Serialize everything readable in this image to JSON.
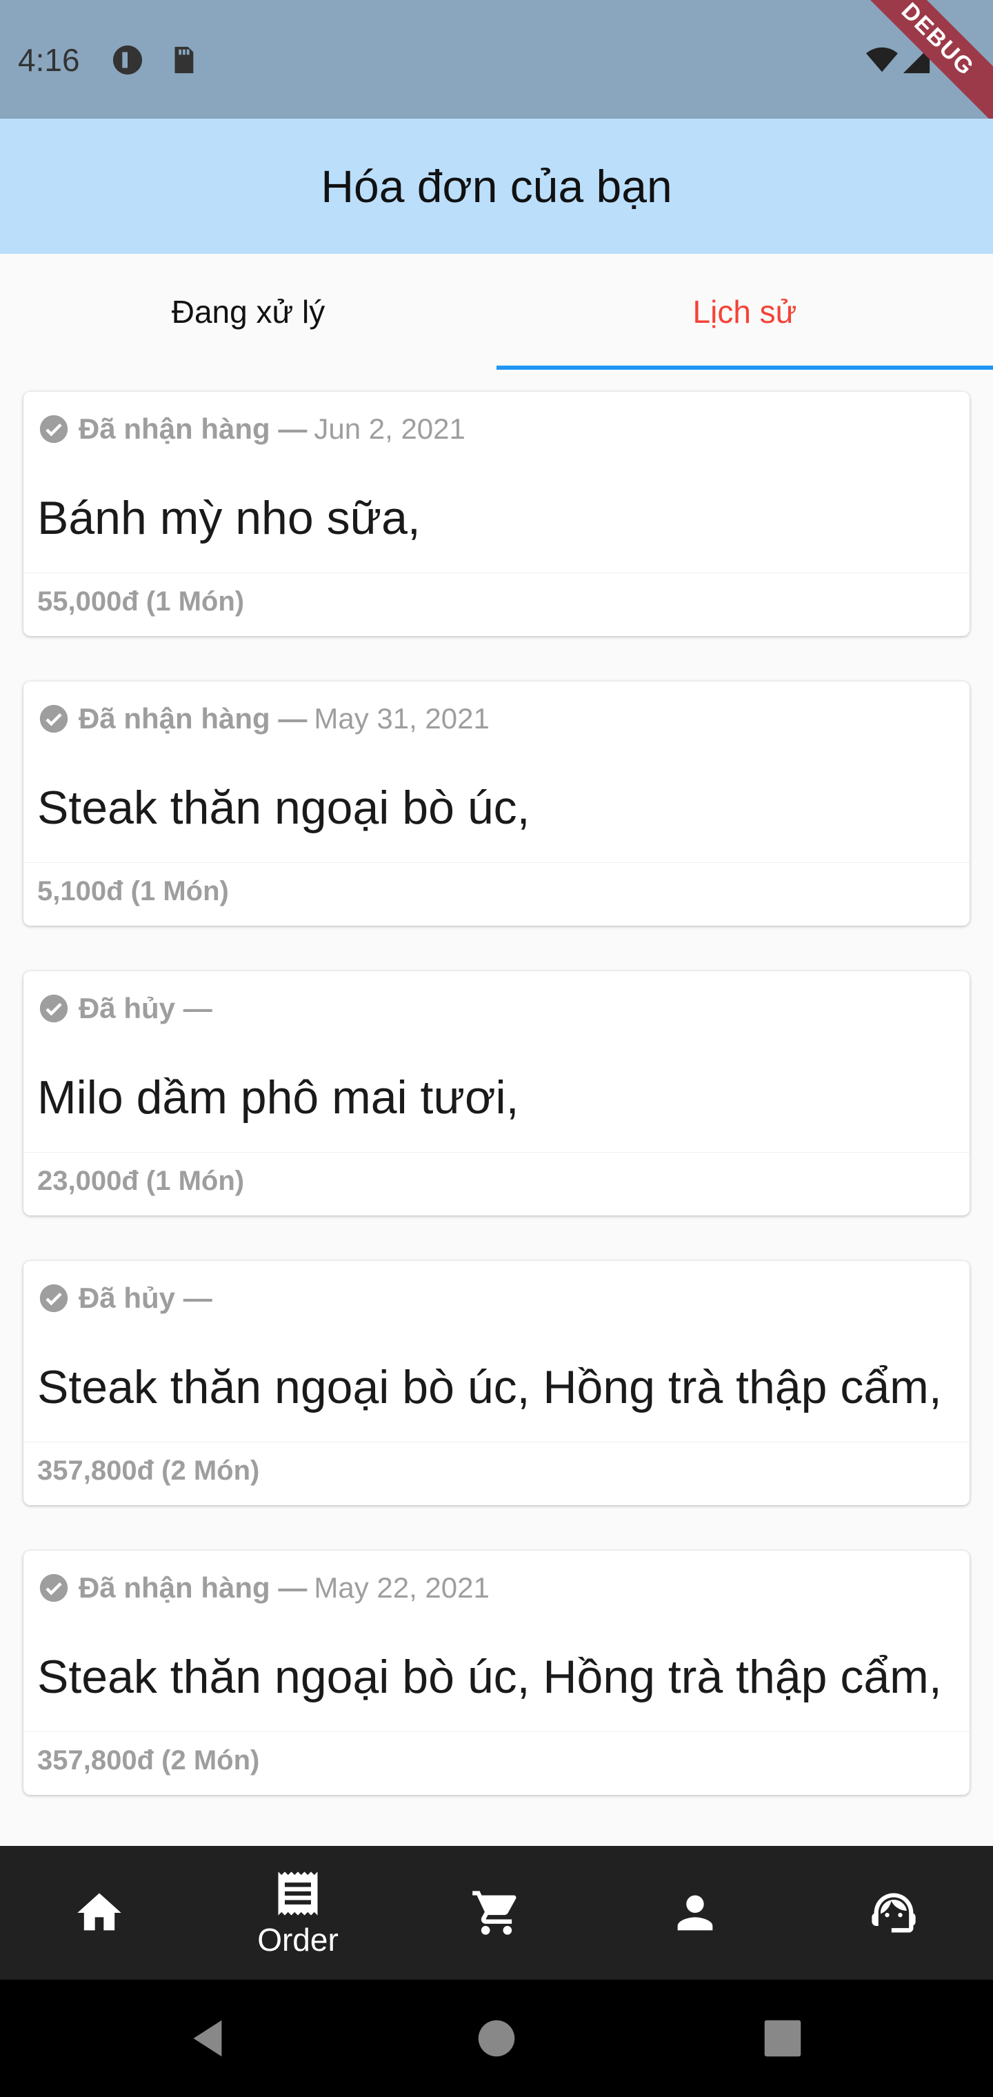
{
  "status_bar": {
    "time": "4:16",
    "debug_label": "DEBUG"
  },
  "app_bar": {
    "title": "Hóa đơn của bạn"
  },
  "tabs": [
    {
      "label": "Đang xử lý",
      "active": false
    },
    {
      "label": "Lịch sử",
      "active": true
    }
  ],
  "orders": [
    {
      "status": "Đã nhận hàng —",
      "date": "Jun 2, 2021",
      "items": "Bánh mỳ nho sữa,",
      "total": "55,000đ (1 Món)"
    },
    {
      "status": "Đã nhận hàng —",
      "date": "May 31, 2021",
      "items": "Steak thăn ngoại bò úc,",
      "total": "5,100đ (1 Món)"
    },
    {
      "status": "Đã hủy —",
      "date": "",
      "items": "Milo dầm phô mai tươi,",
      "total": "23,000đ (1 Món)"
    },
    {
      "status": "Đã hủy —",
      "date": "",
      "items": "Steak thăn ngoại bò úc, Hồng trà thập cẩm,",
      "total": "357,800đ (2 Món)"
    },
    {
      "status": "Đã nhận hàng —",
      "date": "May 22, 2021",
      "items": "Steak thăn ngoại bò úc, Hồng trà thập cẩm,",
      "total": "357,800đ (2 Món)"
    }
  ],
  "bottom_nav": {
    "items": [
      {
        "icon": "home-icon",
        "label": ""
      },
      {
        "icon": "receipt-icon",
        "label": "Order"
      },
      {
        "icon": "cart-icon",
        "label": ""
      },
      {
        "icon": "person-icon",
        "label": ""
      },
      {
        "icon": "support-agent-icon",
        "label": ""
      }
    ]
  },
  "colors": {
    "status_bar": "#8aa6be",
    "app_bar": "#bbdefb",
    "active_tab_text": "#f44336",
    "tab_indicator": "#2196f3",
    "bottom_nav": "#212121",
    "muted_text": "#9e9e9e"
  }
}
